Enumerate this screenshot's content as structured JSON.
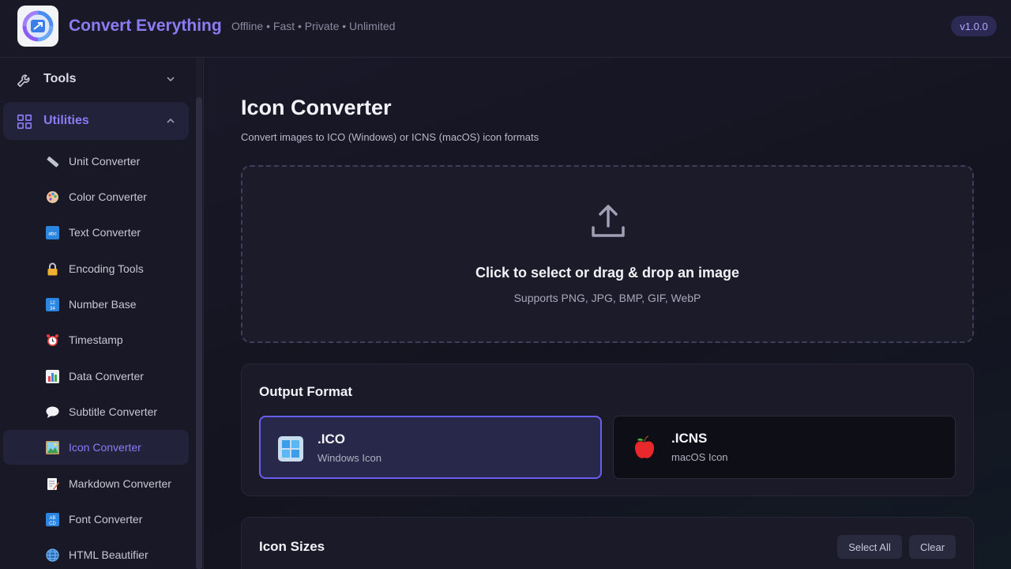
{
  "header": {
    "title": "Convert Everything",
    "tagline": "Offline • Fast • Private • Unlimited",
    "version": "v1.0.0"
  },
  "sidebar": {
    "groups": [
      {
        "label": "Tools",
        "icon": "wrench-icon",
        "expanded": false
      },
      {
        "label": "Utilities",
        "icon": "grid-icon",
        "expanded": true
      }
    ],
    "items": [
      {
        "label": "Unit Converter",
        "icon": "ruler-icon"
      },
      {
        "label": "Color Converter",
        "icon": "palette-icon"
      },
      {
        "label": "Text Converter",
        "icon": "abc-icon"
      },
      {
        "label": "Encoding Tools",
        "icon": "lock-icon"
      },
      {
        "label": "Number Base",
        "icon": "numbers-icon"
      },
      {
        "label": "Timestamp",
        "icon": "alarm-clock-icon"
      },
      {
        "label": "Data Converter",
        "icon": "bar-chart-icon"
      },
      {
        "label": "Subtitle Converter",
        "icon": "speech-bubble-icon"
      },
      {
        "label": "Icon Converter",
        "icon": "picture-icon",
        "active": true
      },
      {
        "label": "Markdown Converter",
        "icon": "memo-icon"
      },
      {
        "label": "Font Converter",
        "icon": "abcd-icon"
      },
      {
        "label": "HTML Beautifier",
        "icon": "globe-icon"
      }
    ]
  },
  "main": {
    "title": "Icon Converter",
    "subtitle": "Convert images to ICO (Windows) or ICNS (macOS) icon formats",
    "dropzone": {
      "title": "Click to select or drag & drop an image",
      "subtitle": "Supports PNG, JPG, BMP, GIF, WebP"
    },
    "output_format": {
      "title": "Output Format",
      "options": [
        {
          "name": ".ICO",
          "desc": "Windows Icon",
          "icon": "windows-icon",
          "selected": true
        },
        {
          "name": ".ICNS",
          "desc": "macOS Icon",
          "icon": "apple-icon",
          "selected": false
        }
      ]
    },
    "icon_sizes": {
      "title": "Icon Sizes",
      "select_all": "Select All",
      "clear": "Clear"
    }
  },
  "colors": {
    "accent": "#8b7cf6",
    "background": "#14141f",
    "panel": "#1a1a29"
  }
}
